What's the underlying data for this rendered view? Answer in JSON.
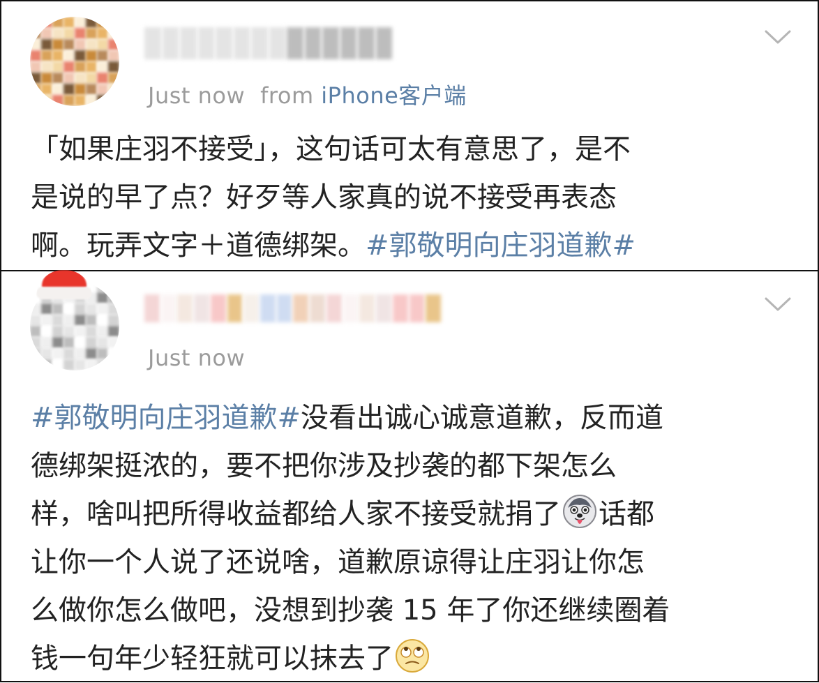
{
  "feed": {
    "comments": [
      {
        "meta_time": "Just now",
        "meta_from": "from",
        "meta_source": "iPhone客户端",
        "line1": "「如果庄羽不接受」，这句话可太有意思了，是不",
        "line2": "是说的早了点？好歹等人家真的说不接受再表态",
        "line3_text": "啊。玩弄文字＋道德绑架。",
        "line3_hashtag": "#郭敬明向庄羽道歉#",
        "more_icon": "chevron-down-icon",
        "avatar_icon": "pixelated-avatar"
      },
      {
        "meta_time": "Just now",
        "line1_hashtag": "#郭敬明向庄羽道歉#",
        "line1_text": "没看出诚心诚意道歉，反而道",
        "line2": "德绑架挺浓的，要不把你涉及抄袭的都下架怎么",
        "line3_text": "样，啥叫把所得收益都给人家不接受就捐了",
        "line3_emoji": "husky-tongue-emoji",
        "line3_tail": "话都",
        "line4": "让你一个人说了还说啥，道歉原谅得让庄羽让你怎",
        "line5": "么做你怎么做吧，没想到抄袭 15 年了你还继续圈着",
        "line6_text": "钱一句年少轻狂就可以抹去了",
        "line6_emoji": "eye-roll-emoji",
        "more_icon": "chevron-down-icon",
        "avatar_icon": "pixelated-avatar-santa-hat"
      }
    ]
  },
  "colors": {
    "text": "#222222",
    "meta": "#9b9b9b",
    "link": "#5b7fa6",
    "border": "#111111"
  }
}
